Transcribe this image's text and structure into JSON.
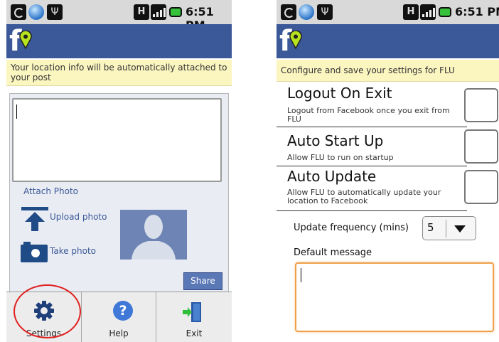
{
  "status": {
    "time": "6:51 PM",
    "network": "H"
  },
  "left": {
    "notice": "Your location info will be automatically attached to your post",
    "post_text": "",
    "attach_photo": "Attach Photo",
    "upload_photo": "Upload photo",
    "take_photo": "Take photo",
    "share": "Share",
    "menu": [
      {
        "label": "Settings",
        "icon": "gear-icon"
      },
      {
        "label": "Help",
        "icon": "help-icon"
      },
      {
        "label": "Exit",
        "icon": "exit-icon"
      }
    ]
  },
  "right": {
    "notice": "Configure and save your settings for FLU",
    "settings": [
      {
        "title": "Logout On Exit",
        "desc": "Logout from Facebook once you exit from FLU",
        "checked": false
      },
      {
        "title": "Auto Start Up",
        "desc": "Allow FLU to run on startup",
        "checked": false
      },
      {
        "title": "Auto Update",
        "desc": "Allow FLU to automatically update your location to Facebook",
        "checked": false
      }
    ],
    "update_frequency_label": "Update frequency (mins)",
    "update_frequency_value": "5",
    "default_message_label": "Default message",
    "default_message_value": ""
  },
  "colors": {
    "brand": "#3b5998",
    "notice_bg": "#fbf5c0",
    "highlight_ring": "#e02020",
    "focus_border": "#f0a04b"
  }
}
